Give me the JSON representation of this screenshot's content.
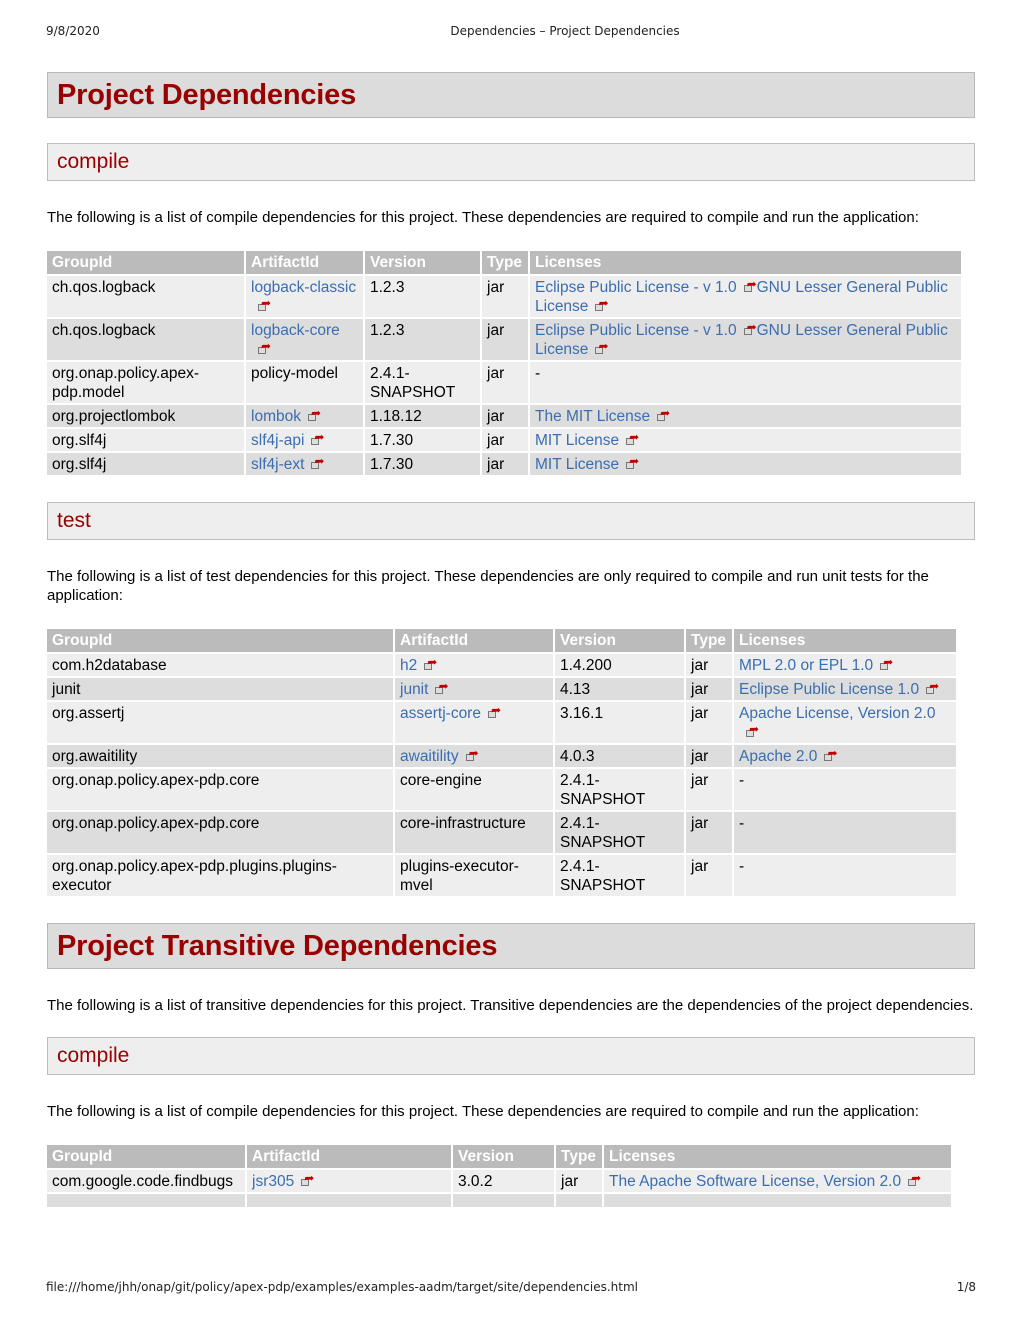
{
  "print_header": {
    "date": "9/8/2020",
    "title": "Dependencies – Project Dependencies"
  },
  "print_footer": {
    "url": "file:///home/jhh/onap/git/policy/apex-pdp/examples/examples-aadm/target/site/dependencies.html",
    "page": "1/8"
  },
  "colors": {
    "heading": "#990000",
    "link": "#3b6db0",
    "table_header_bg": "#bbbbbb"
  },
  "project_dependencies": {
    "title": "Project Dependencies",
    "compile": {
      "title": "compile",
      "description": "The following is a list of compile dependencies for this project. These dependencies are required to compile and run the application:",
      "headers": [
        "GroupId",
        "ArtifactId",
        "Version",
        "Type",
        "Licenses"
      ],
      "rows": [
        {
          "group": "ch.qos.logback",
          "artifact": "logback-classic",
          "artifact_link": true,
          "version": "1.2.3",
          "type": "jar",
          "licenses": [
            "Eclipse Public License - v 1.0",
            "GNU Lesser General Public License"
          ]
        },
        {
          "group": "ch.qos.logback",
          "artifact": "logback-core",
          "artifact_link": true,
          "version": "1.2.3",
          "type": "jar",
          "licenses": [
            "Eclipse Public License - v 1.0",
            "GNU Lesser General Public License"
          ]
        },
        {
          "group": "org.onap.policy.apex-pdp.model",
          "artifact": "policy-model",
          "artifact_link": false,
          "version": "2.4.1-SNAPSHOT",
          "type": "jar",
          "licenses": [],
          "license_text": "-"
        },
        {
          "group": "org.projectlombok",
          "artifact": "lombok",
          "artifact_link": true,
          "version": "1.18.12",
          "type": "jar",
          "licenses": [
            "The MIT License"
          ]
        },
        {
          "group": "org.slf4j",
          "artifact": "slf4j-api",
          "artifact_link": true,
          "version": "1.7.30",
          "type": "jar",
          "licenses": [
            "MIT License"
          ]
        },
        {
          "group": "org.slf4j",
          "artifact": "slf4j-ext",
          "artifact_link": true,
          "version": "1.7.30",
          "type": "jar",
          "licenses": [
            "MIT License"
          ]
        }
      ]
    },
    "test": {
      "title": "test",
      "description": "The following is a list of test dependencies for this project. These dependencies are only required to compile and run unit tests for the application:",
      "headers": [
        "GroupId",
        "ArtifactId",
        "Version",
        "Type",
        "Licenses"
      ],
      "rows": [
        {
          "group": "com.h2database",
          "artifact": "h2",
          "artifact_link": true,
          "version": "1.4.200",
          "type": "jar",
          "licenses": [
            "MPL 2.0 or EPL 1.0"
          ]
        },
        {
          "group": "junit",
          "artifact": "junit",
          "artifact_link": true,
          "version": "4.13",
          "type": "jar",
          "licenses": [
            "Eclipse Public License 1.0"
          ]
        },
        {
          "group": "org.assertj",
          "artifact": "assertj-core",
          "artifact_link": true,
          "version": "3.16.1",
          "type": "jar",
          "licenses": [
            "Apache License, Version 2.0"
          ]
        },
        {
          "group": "org.awaitility",
          "artifact": "awaitility",
          "artifact_link": true,
          "version": "4.0.3",
          "type": "jar",
          "licenses": [
            "Apache 2.0"
          ]
        },
        {
          "group": "org.onap.policy.apex-pdp.core",
          "artifact": "core-engine",
          "artifact_link": false,
          "version": "2.4.1-SNAPSHOT",
          "type": "jar",
          "licenses": [],
          "license_text": "-"
        },
        {
          "group": "org.onap.policy.apex-pdp.core",
          "artifact": "core-infrastructure",
          "artifact_link": false,
          "version": "2.4.1-SNAPSHOT",
          "type": "jar",
          "licenses": [],
          "license_text": "-"
        },
        {
          "group": "org.onap.policy.apex-pdp.plugins.plugins-executor",
          "artifact": "plugins-executor-mvel",
          "artifact_link": false,
          "version": "2.4.1-SNAPSHOT",
          "type": "jar",
          "licenses": [],
          "license_text": "-"
        }
      ]
    }
  },
  "transitive_dependencies": {
    "title": "Project Transitive Dependencies",
    "description": "The following is a list of transitive dependencies for this project. Transitive dependencies are the dependencies of the project dependencies.",
    "compile": {
      "title": "compile",
      "description": "The following is a list of compile dependencies for this project. These dependencies are required to compile and run the application:",
      "headers": [
        "GroupId",
        "ArtifactId",
        "Version",
        "Type",
        "Licenses"
      ],
      "rows": [
        {
          "group": "com.google.code.findbugs",
          "artifact": "jsr305",
          "artifact_link": true,
          "version": "3.0.2",
          "type": "jar",
          "licenses": [
            "The Apache Software License, Version 2.0"
          ]
        }
      ]
    }
  }
}
